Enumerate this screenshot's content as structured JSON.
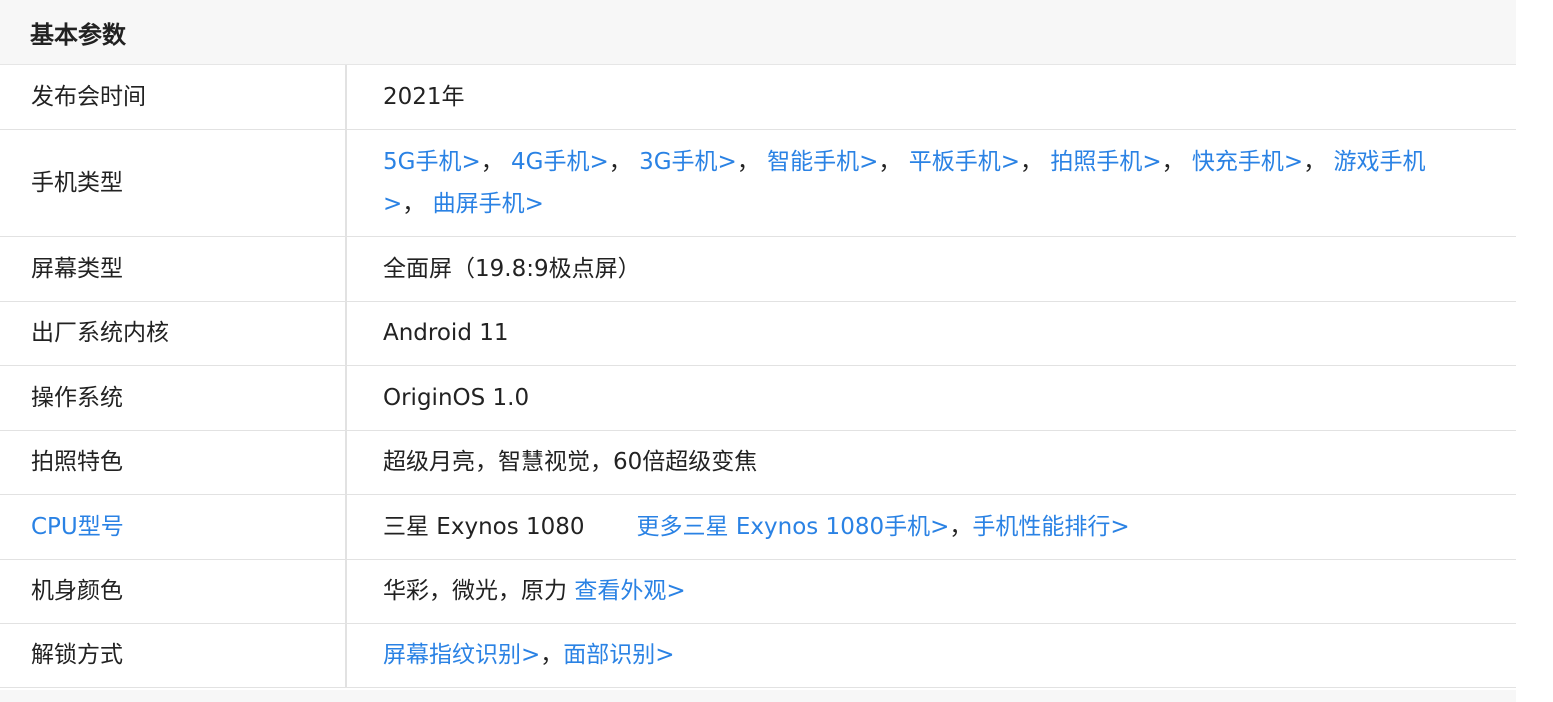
{
  "section": {
    "title": "基本参数"
  },
  "rows": [
    {
      "key": "发布会时间",
      "value": "2021年"
    },
    {
      "key": "手机类型",
      "links": [
        "5G手机>",
        "4G手机>",
        "3G手机>",
        "智能手机>",
        "平板手机>",
        "拍照手机>",
        "快充手机>",
        "游戏手机>",
        "曲屏手机>"
      ]
    },
    {
      "key": "屏幕类型",
      "value": "全面屏（19.8:9极点屏）"
    },
    {
      "key": "出厂系统内核",
      "value": "Android 11"
    },
    {
      "key": "操作系统",
      "value": "OriginOS 1.0"
    },
    {
      "key": "拍照特色",
      "value": "超级月亮，智慧视觉，60倍超级变焦"
    },
    {
      "key": "CPU型号",
      "value": "三星 Exynos 1080",
      "link1": "更多三星 Exynos 1080手机>",
      "link2": "手机性能排行>"
    },
    {
      "key": "机身颜色",
      "value": "华彩，微光，原力",
      "link": "查看外观>"
    },
    {
      "key": "解锁方式",
      "link1": "屏幕指纹识别>",
      "link2": "面部识别>"
    }
  ],
  "separator": "，",
  "colors": {
    "link": "#2a82e4",
    "text": "#222222",
    "header_bg": "#f7f7f7",
    "border": "#e2e2e2"
  }
}
